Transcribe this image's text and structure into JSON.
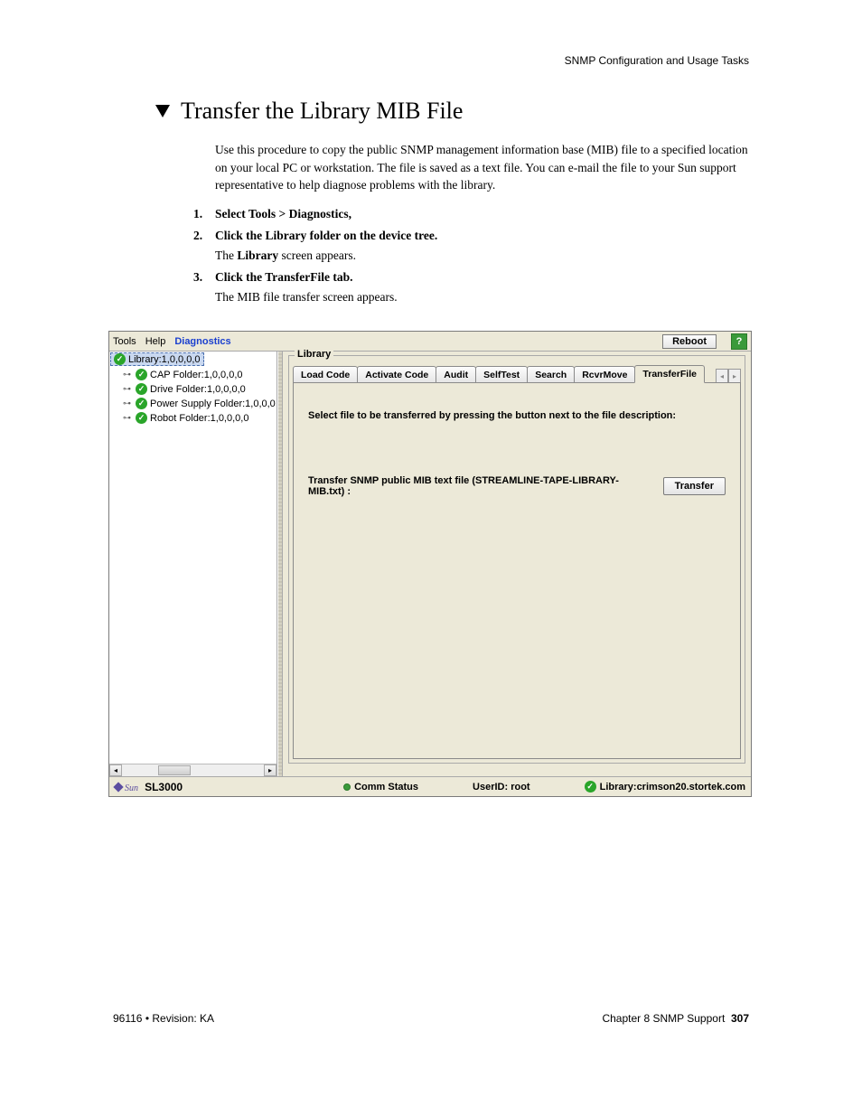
{
  "header": {
    "section": "SNMP Configuration and Usage Tasks"
  },
  "heading": "Transfer the Library MIB File",
  "intro": "Use this procedure to copy the public SNMP management information base (MIB) file to a specified location on your local PC or workstation. The file is saved as a text file. You can e-mail the file to your Sun support representative to help diagnose problems with the library.",
  "steps": [
    {
      "num": "1.",
      "text": "Select Tools > Diagnostics,"
    },
    {
      "num": "2.",
      "text": "Click the Library folder on the device tree.",
      "sub_pre": "The ",
      "sub_bold": "Library",
      "sub_post": " screen appears."
    },
    {
      "num": "3.",
      "text": "Click the TransferFile tab.",
      "sub_plain": "The MIB file transfer screen appears."
    }
  ],
  "app": {
    "menu": {
      "tools": "Tools",
      "help": "Help",
      "diagnostics": "Diagnostics",
      "reboot": "Reboot"
    },
    "tree": {
      "root": "Library:1,0,0,0,0",
      "items": [
        "CAP Folder:1,0,0,0,0",
        "Drive Folder:1,0,0,0,0",
        "Power Supply Folder:1,0,0,0",
        "Robot Folder:1,0,0,0,0"
      ]
    },
    "fieldset_title": "Library",
    "tabs": [
      "Load Code",
      "Activate Code",
      "Audit",
      "SelfTest",
      "Search",
      "RcvrMove",
      "TransferFile"
    ],
    "active_tab": "TransferFile",
    "instruction": "Select file to be transferred by pressing the button next to the file description:",
    "transfer_label": "Transfer SNMP public MIB text file (STREAMLINE-TAPE-LIBRARY-MIB.txt) :",
    "transfer_button": "Transfer",
    "status": {
      "brand": "Sun",
      "model": "SL3000",
      "comm": "Comm Status",
      "user_label": "UserID: ",
      "user": "root",
      "library_label": "Library:",
      "library": "crimson20.stortek.com"
    }
  },
  "footer": {
    "left": "96116 • Revision: KA",
    "right_prefix": "Chapter 8 SNMP Support",
    "page": "307"
  }
}
